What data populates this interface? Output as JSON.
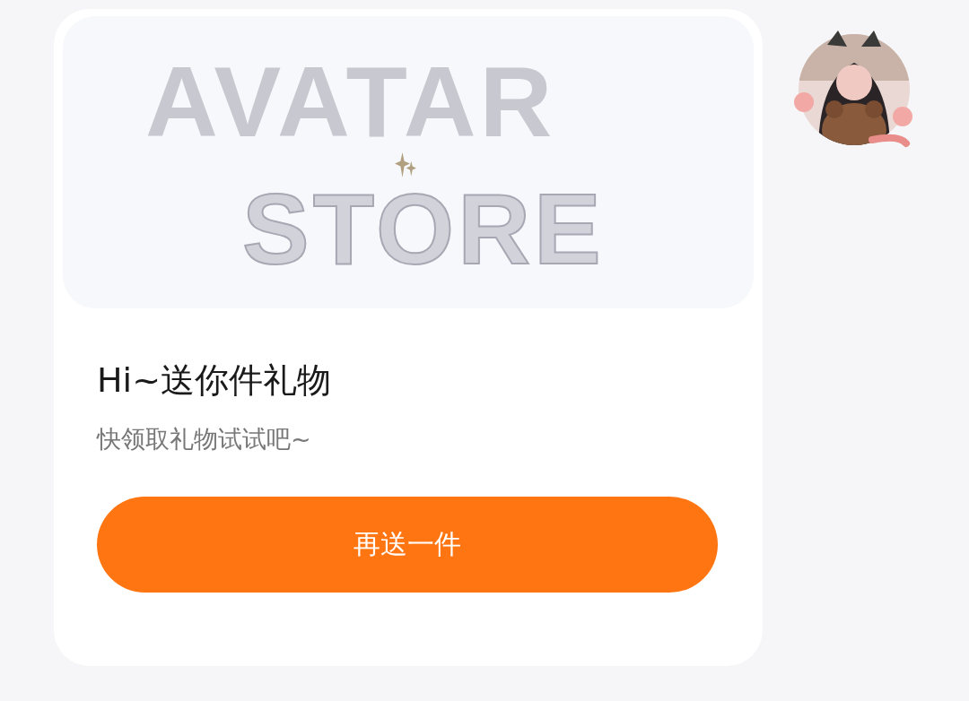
{
  "banner": {
    "line_1": "AVATAR",
    "line_2": "STORE"
  },
  "message": {
    "title": "Hi~送你件礼物",
    "subtitle": "快领取礼物试试吧~"
  },
  "button": {
    "label": "再送一件"
  }
}
